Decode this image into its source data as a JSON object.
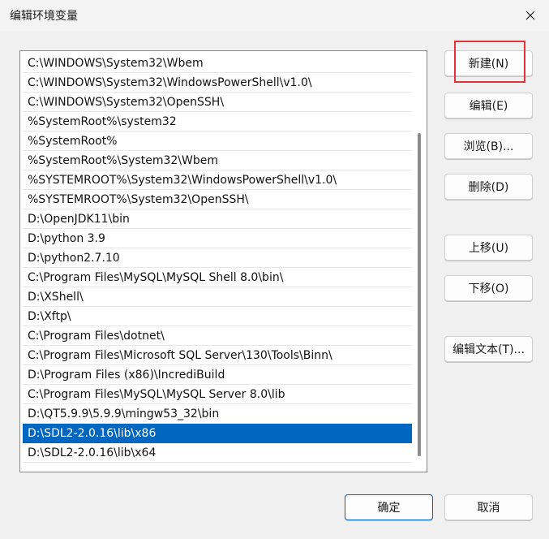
{
  "window": {
    "title": "编辑环境变量",
    "close_icon": "close-icon"
  },
  "paths": [
    "C:\\WINDOWS\\System32\\Wbem",
    "C:\\WINDOWS\\System32\\WindowsPowerShell\\v1.0\\",
    "C:\\WINDOWS\\System32\\OpenSSH\\",
    "%SystemRoot%\\system32",
    "%SystemRoot%",
    "%SystemRoot%\\System32\\Wbem",
    "%SYSTEMROOT%\\System32\\WindowsPowerShell\\v1.0\\",
    "%SYSTEMROOT%\\System32\\OpenSSH\\",
    "D:\\OpenJDK11\\bin",
    "D:\\python 3.9",
    "D:\\python2.7.10",
    "C:\\Program Files\\MySQL\\MySQL Shell 8.0\\bin\\",
    "D:\\XShell\\",
    "D:\\Xftp\\",
    "C:\\Program Files\\dotnet\\",
    "C:\\Program Files\\Microsoft SQL Server\\130\\Tools\\Binn\\",
    "D:\\Program Files (x86)\\IncrediBuild",
    "C:\\Program Files\\MySQL\\MySQL Server 8.0\\lib",
    "D:\\QT5.9.9\\5.9.9\\mingw53_32\\bin",
    "D:\\SDL2-2.0.16\\lib\\x86",
    "D:\\SDL2-2.0.16\\lib\\x64"
  ],
  "selected_index": 19,
  "buttons": {
    "new": "新建(N)",
    "edit": "编辑(E)",
    "browse": "浏览(B)...",
    "delete": "删除(D)",
    "move_up": "上移(U)",
    "move_down": "下移(O)",
    "edit_text": "编辑文本(T)...",
    "ok": "确定",
    "cancel": "取消"
  },
  "colors": {
    "selection": "#0067c0",
    "annotation": "#e0333a"
  }
}
